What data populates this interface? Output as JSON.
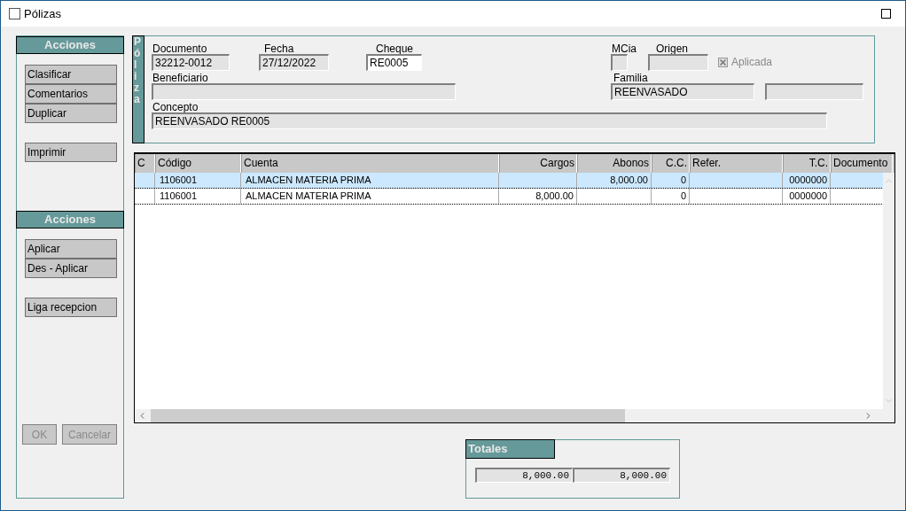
{
  "window": {
    "title": "Pólizas"
  },
  "left_panel": {
    "sections": [
      {
        "title": "Acciones",
        "groups": [
          [
            "Clasificar",
            "Comentarios",
            "Duplicar"
          ],
          [
            "Imprimir"
          ]
        ]
      },
      {
        "title": "Acciones",
        "groups": [
          [
            "Aplicar",
            "Des - Aplicar"
          ],
          [
            "Liga recepcion"
          ]
        ]
      }
    ],
    "footer_buttons": [
      {
        "label": "OK",
        "disabled": true
      },
      {
        "label": "Cancelar",
        "disabled": true
      }
    ]
  },
  "poliza": {
    "title": "Póliza",
    "documento": {
      "label": "Documento",
      "value": "32212-0012"
    },
    "fecha": {
      "label": "Fecha",
      "value": "27/12/2022"
    },
    "cheque": {
      "label": "Cheque",
      "value": "RE0005"
    },
    "mcia": {
      "label": "MCia"
    },
    "origen": {
      "label": "Origen"
    },
    "aplicada": {
      "label": "Aplicada",
      "checked": true,
      "disabled": true
    },
    "beneficiario": {
      "label": "Beneficiario"
    },
    "familia": {
      "label": "Familia",
      "value": "REENVASADO"
    },
    "concepto": {
      "label": "Concepto",
      "value": "REENVASADO RE0005"
    }
  },
  "table": {
    "columns": [
      "C",
      "Código",
      "Cuenta",
      "Cargos",
      "Abonos",
      "C.C.",
      "Refer.",
      "T.C.",
      "Documento"
    ],
    "rows": [
      {
        "selected": true,
        "cells": [
          "",
          "1106001",
          "ALMACEN MATERIA PRIMA",
          "",
          "8,000.00",
          "0",
          "",
          "0000000",
          ""
        ]
      },
      {
        "selected": false,
        "cells": [
          "",
          "1106001",
          "ALMACEN MATERIA PRIMA",
          "8,000.00",
          "",
          "0",
          "",
          "0000000",
          ""
        ]
      }
    ]
  },
  "totales": {
    "title": "Totales",
    "values": [
      "8,000.00",
      "8,000.00"
    ]
  }
}
